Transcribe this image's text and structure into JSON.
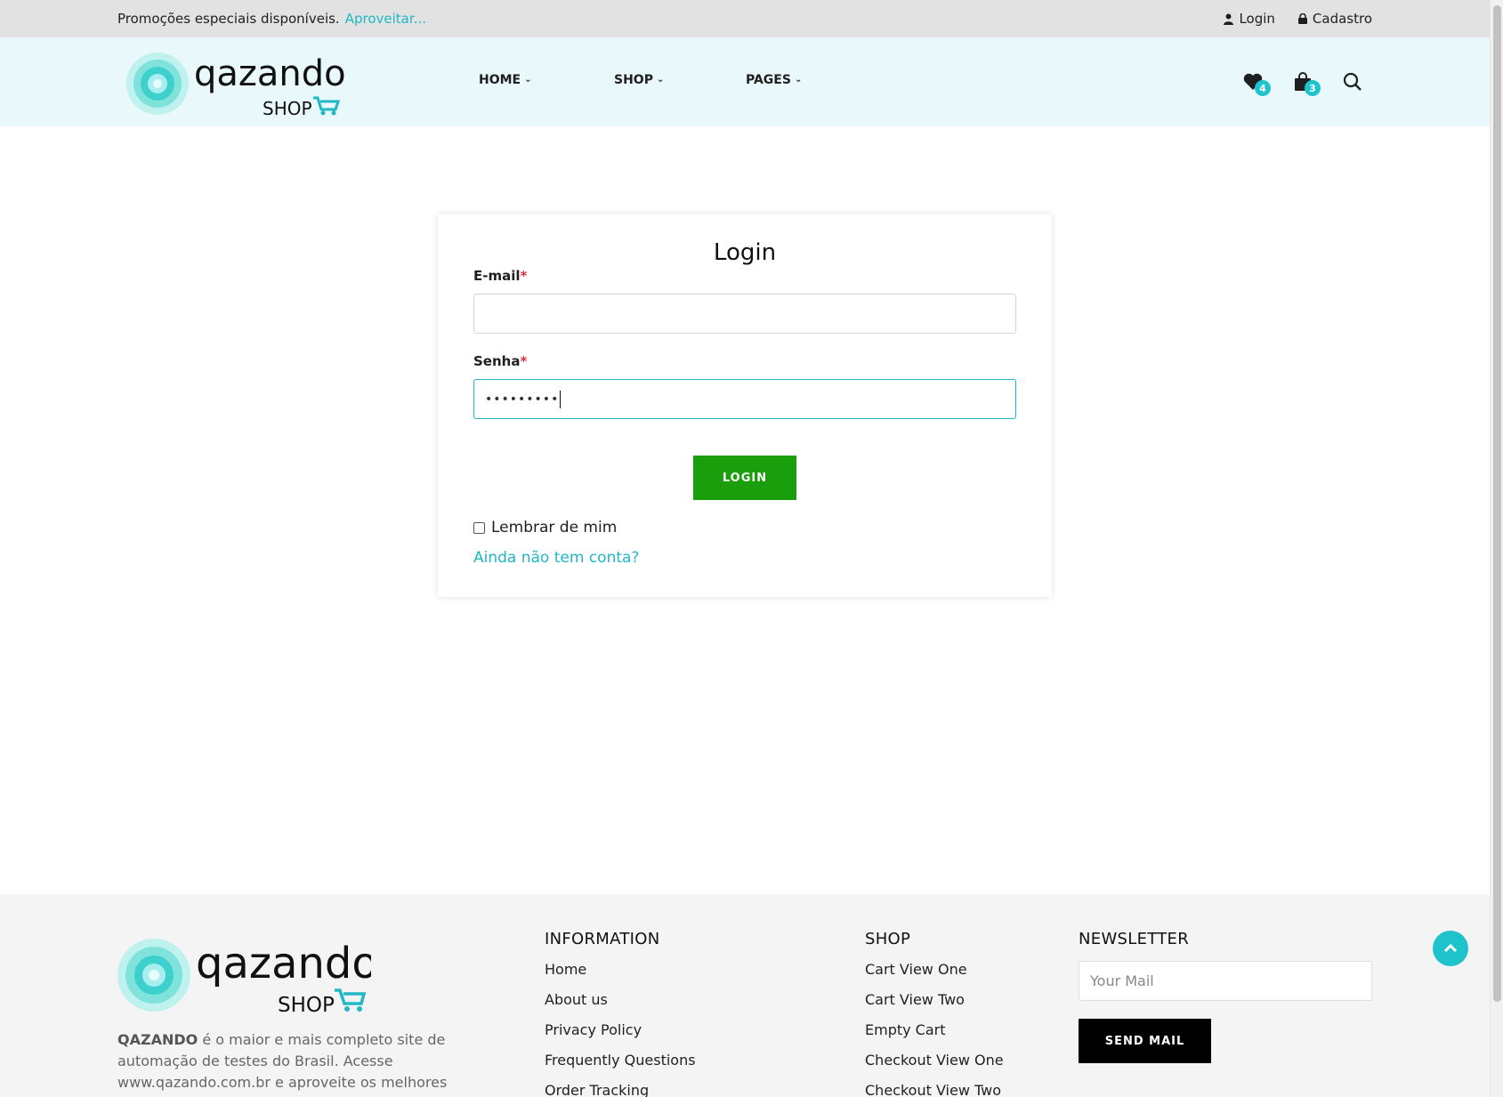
{
  "topbar": {
    "promo_text": "Promoções especiais disponíveis.",
    "promo_link": "Aproveitar...",
    "login_link": "Login",
    "signup_link": "Cadastro"
  },
  "header": {
    "logo_text": "qazando",
    "logo_sub": "SHOP",
    "nav": [
      {
        "label": "HOME"
      },
      {
        "label": "SHOP"
      },
      {
        "label": "PAGES"
      }
    ],
    "wishlist_count": "4",
    "cart_count": "3"
  },
  "login_form": {
    "title": "Login",
    "email_label": "E-mail",
    "email_value": "",
    "password_label": "Senha",
    "password_value": "•••••••••",
    "required_mark": "*",
    "submit_label": "LOGIN",
    "remember_label": "Lembrar de mim",
    "remember_checked": false,
    "signup_link": "Ainda não tem conta?"
  },
  "footer": {
    "logo_text": "qazando",
    "logo_sub": "SHOP",
    "brand": "QAZANDO",
    "description": " é o maior e mais completo site de automação de testes do Brasil. Acesse www.qazando.com.br e aproveite os melhores",
    "information": {
      "title": "INFORMATION",
      "items": [
        "Home",
        "About us",
        "Privacy Policy",
        "Frequently Questions",
        "Order Tracking"
      ]
    },
    "shop": {
      "title": "SHOP",
      "items": [
        "Cart View One",
        "Cart View Two",
        "Empty Cart",
        "Checkout View One",
        "Checkout View Two"
      ]
    },
    "newsletter": {
      "title": "NEWSLETTER",
      "placeholder": "Your Mail",
      "button": "SEND MAIL"
    }
  },
  "colors": {
    "accent": "#1fb8c4",
    "login_button": "#1a9e0b",
    "header_bg": "#e8f8fb",
    "topbar_bg": "#e2e2e2"
  }
}
